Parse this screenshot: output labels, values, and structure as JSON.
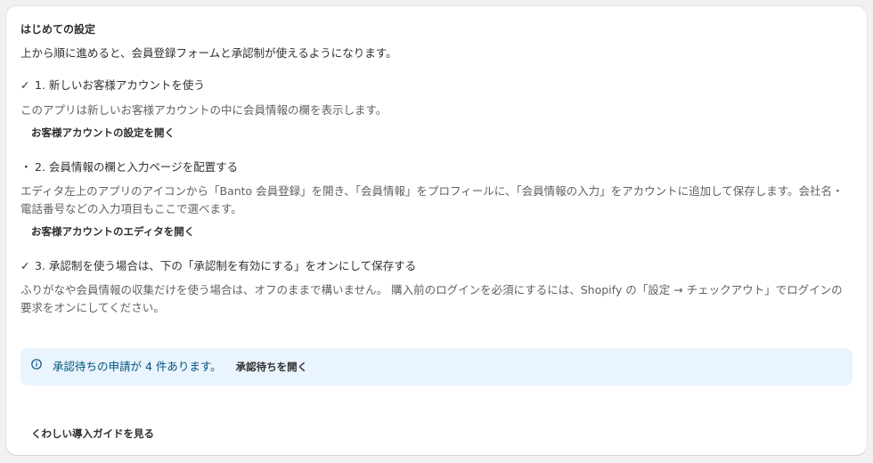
{
  "card": {
    "title": "はじめての設定",
    "intro": "上から順に進めると、会員登録フォームと承認制が使えるようになります。"
  },
  "steps": [
    {
      "marker": "✓",
      "heading": "1. 新しいお客様アカウントを使う",
      "description": "このアプリは新しいお客様アカウントの中に会員情報の欄を表示します。",
      "action": "お客様アカウントの設定を開く"
    },
    {
      "marker": "・",
      "heading": "2. 会員情報の欄と入力ページを配置する",
      "description": "エディタ左上のアプリのアイコンから「Banto 会員登録」を開き、「会員情報」をプロフィールに、「会員情報の入力」をアカウントに追加して保存します。会社名・電話番号などの入力項目もここで選べます。",
      "action": "お客様アカウントのエディタを開く"
    },
    {
      "marker": "✓",
      "heading": "3. 承認制を使う場合は、下の「承認制を有効にする」をオンにして保存する",
      "description": "ふりがなや会員情報の収集だけを使う場合は、オフのままで構いません。 購入前のログインを必須にするには、Shopify の「設定 → チェックアウト」でログインの要求をオンにしてください。"
    }
  ],
  "banner": {
    "text": "承認待ちの申請が 4 件あります。",
    "action": "承認待ちを開く"
  },
  "guide_link": "くわしい導入ガイドを見る"
}
